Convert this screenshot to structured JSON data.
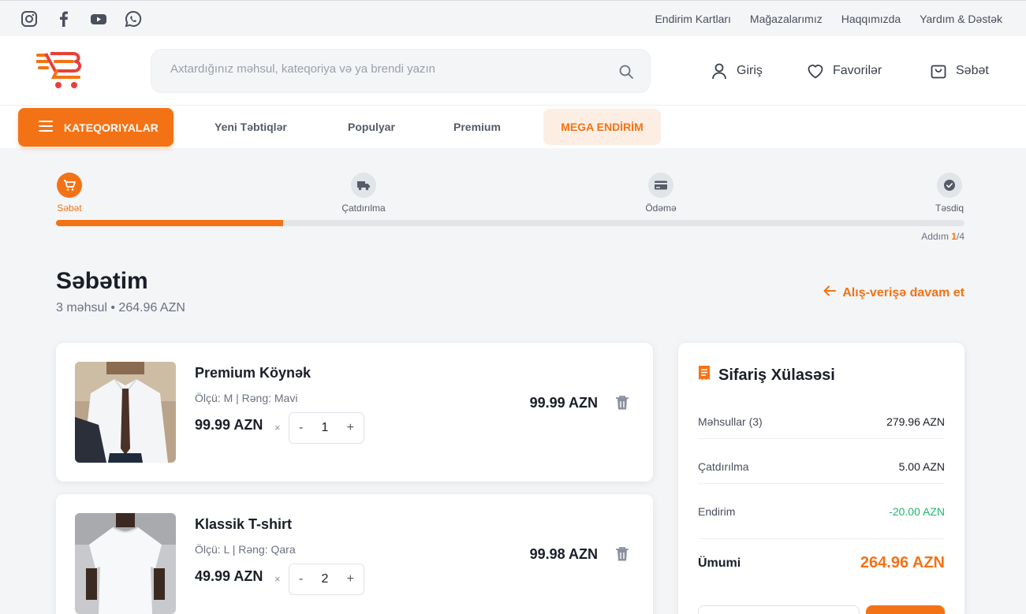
{
  "topbar": {
    "social": [
      "instagram-icon",
      "facebook-icon",
      "youtube-icon",
      "whatsapp-icon"
    ],
    "links": [
      "Endirim Kartları",
      "Mağazalarımız",
      "Haqqımızda",
      "Yardım & Dəstək"
    ]
  },
  "header": {
    "search_placeholder": "Axtardığınız məhsul, kateqoriya və ya brendi yazın",
    "login": "Giriş",
    "favorites": "Favorilər",
    "cart": "Səbət"
  },
  "nav": {
    "categories": "KATEQORIYALAR",
    "links": [
      "Yeni Təbtiqlər",
      "Populyar",
      "Premium"
    ],
    "mega": "MEGA ENDİRİM"
  },
  "stepper": {
    "steps": [
      "Səbət",
      "Çatdırılma",
      "Ödəmə",
      "Təsdiq"
    ],
    "active": 0,
    "progress": 0.25,
    "step_label": "Addım ",
    "step_current": "1",
    "step_total": "/4"
  },
  "cart": {
    "title": "Səbətim",
    "subtitle": "3 məhsul • 264.96 AZN",
    "continue": "Alış-verişə davam et",
    "items": [
      {
        "name": "Premium Köynək",
        "meta": "Ölçü: M | Rəng: Mavi",
        "price": "99.99 AZN",
        "times": "×",
        "qty": "1",
        "total": "99.99 AZN"
      },
      {
        "name": "Klassik T-shirt",
        "meta": "Ölçü: L | Rəng: Qara",
        "price": "49.99 AZN",
        "times": "×",
        "qty": "2",
        "total": "99.98 AZN"
      }
    ],
    "minus": "-",
    "plus": "+"
  },
  "summary": {
    "title": "Sifariş Xülasəsi",
    "rows": [
      {
        "k": "Məhsullar (3)",
        "v": "279.96 AZN"
      },
      {
        "k": "Çatdırılma",
        "v": "5.00 AZN"
      },
      {
        "k": "Endirim",
        "v": "-20.00 AZN"
      }
    ],
    "total_label": "Ümumi",
    "total_value": "264.96 AZN"
  },
  "colors": {
    "accent": "#f47216",
    "discount": "#22b573"
  }
}
